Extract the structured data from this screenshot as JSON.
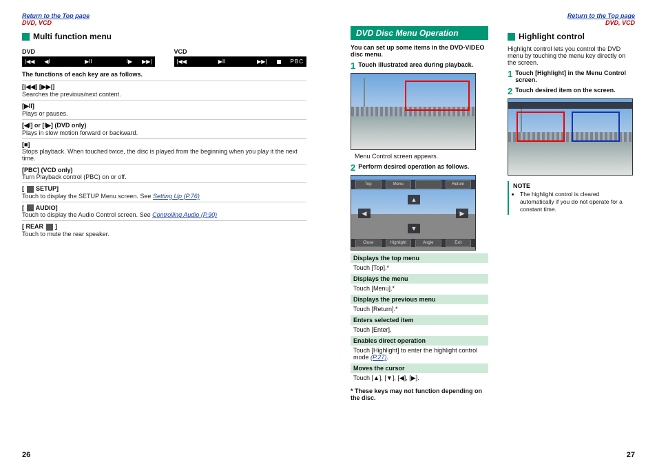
{
  "toplink_return": "Return to the Top page",
  "toplink_section": "DVD, VCD",
  "left": {
    "h2": "Multi function menu",
    "dvd_label": "DVD",
    "vcd_label": "VCD",
    "intro": "The functions of each key are as follows.",
    "items": [
      {
        "k": "[|◀◀] [▶▶|]",
        "d": "Searches the previous/next content."
      },
      {
        "k": "[▶II]",
        "d": "Plays or pauses."
      },
      {
        "k": "[◀I] or [I▶] (DVD only)",
        "d": "Plays in slow motion forward or backward."
      },
      {
        "k": "[■]",
        "d": "Stops playback. When touched twice, the disc is played from the beginning when you play it the next time."
      },
      {
        "k": "[PBC] (VCD only)",
        "d": "Turn Playback control (PBC) on or off."
      },
      {
        "k": "[  SETUP]",
        "d": "Touch to display the SETUP Menu screen. See ",
        "link": "Setting Up (P.76)"
      },
      {
        "k": "[  AUDIO]",
        "d": "Touch to display the Audio Control screen. See ",
        "link": "Controlling Audio (P.90)"
      },
      {
        "k": "[ REAR   ]",
        "d": "Touch to mute the rear speaker."
      }
    ],
    "pagenum": "26"
  },
  "right": {
    "banner": "DVD Disc Menu Operation",
    "intro": "You can set up some items in the DVD-VIDEO disc menu.",
    "step1": "Touch illustrated area during playback.",
    "caption1": "Menu Control screen appears.",
    "step2": "Perform desired operation as follows.",
    "tbl": [
      {
        "h": "Displays the top menu",
        "v": "Touch [Top].*"
      },
      {
        "h": "Displays the menu",
        "v": "Touch [Menu].*"
      },
      {
        "h": "Displays the previous menu",
        "v": "Touch [Return].*"
      },
      {
        "h": "Enters selected item",
        "v": "Touch [Enter]."
      },
      {
        "h": "Enables direct operation",
        "v": "Touch [Highlight] to enter the highlight control mode ",
        "link": "(P.27)",
        "suffix": "."
      },
      {
        "h": "Moves the cursor",
        "v": "Touch [▲], [▼], [◀], [▶]."
      }
    ],
    "footnote": "* These keys may not function depending on the disc.",
    "h2b": "Highlight control",
    "hc_intro": "Highlight control lets you control the DVD menu by touching the menu key directly on the screen.",
    "hc_step1": "Touch [Highlight] in the Menu Control screen.",
    "hc_step2": "Touch desired item on the screen.",
    "note_title": "NOTE",
    "note_item": "The highlight control is cleared automatically if you do not operate for a constant time.",
    "pagenum": "27",
    "menu_bar": {
      "top": "Top",
      "menu": "Menu",
      "return": "Return"
    },
    "foot_bar": {
      "a": "Close",
      "b": "Highlight",
      "c": "Angle",
      "d": "Exit"
    }
  }
}
